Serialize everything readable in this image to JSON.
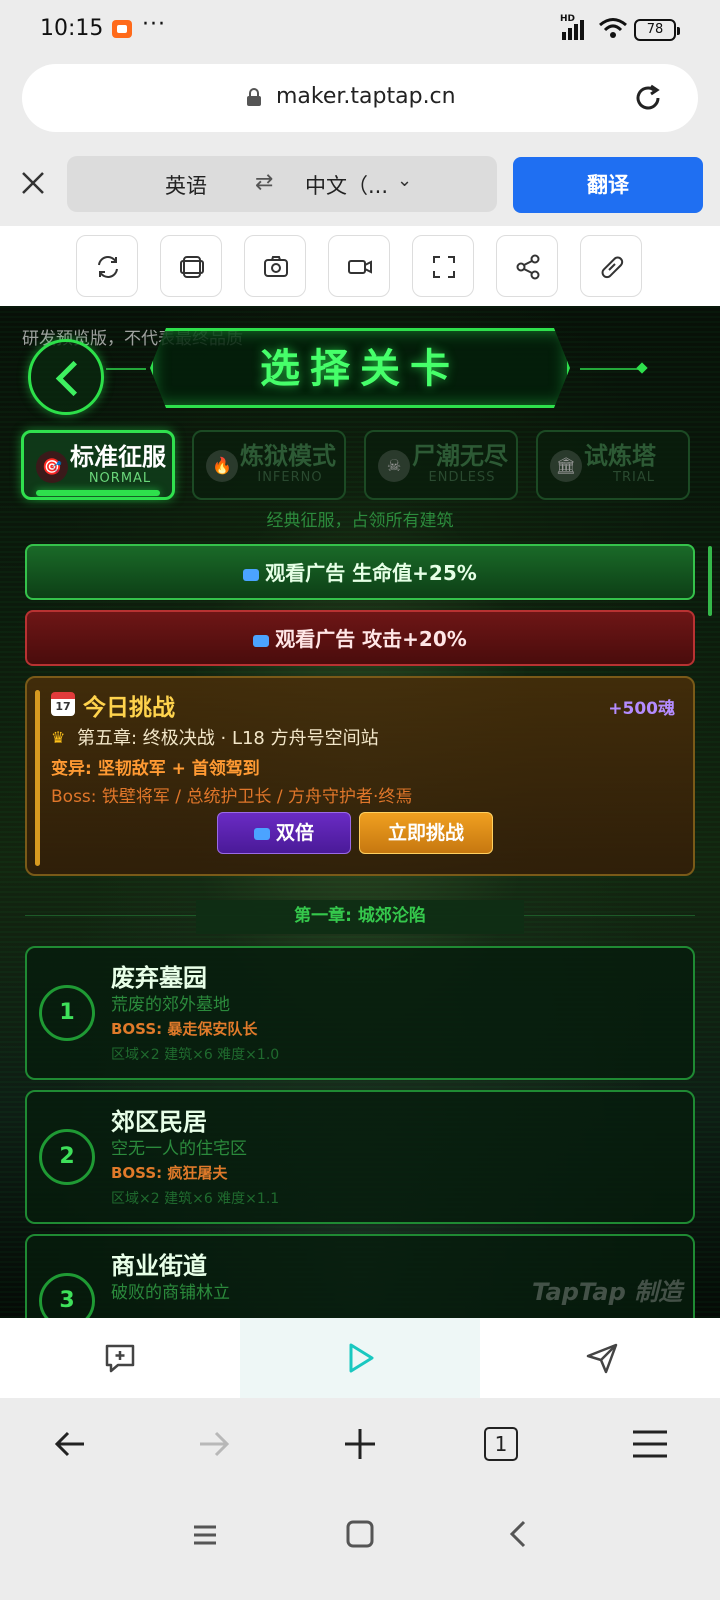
{
  "status_bar": {
    "time": "10:15",
    "dots": "···",
    "hd_label": "HD",
    "battery": "78"
  },
  "browser": {
    "url": "maker.taptap.cn"
  },
  "translate": {
    "source_lang": "英语",
    "swap_symbol": "⇄",
    "target_lang": "中文（...",
    "chevron": "⌄",
    "button": "翻译"
  },
  "tools": [
    "refresh-icon",
    "copy-icon",
    "screenshot-icon",
    "record-icon",
    "fullscreen-icon",
    "share-icon",
    "link-icon"
  ],
  "game": {
    "preview_note": "研发预览版，不代表最终品质",
    "title": "选择关卡",
    "modes": [
      {
        "title": "标准征服",
        "sub": "NORMAL",
        "icon": "🎯"
      },
      {
        "title": "炼狱模式",
        "sub": "INFERNO",
        "icon": "🔥"
      },
      {
        "title": "尸潮无尽",
        "sub": "ENDLESS",
        "icon": "☠"
      },
      {
        "title": "试炼塔",
        "sub": "TRIAL",
        "icon": "🏛"
      }
    ],
    "mode_desc": "经典征服，占领所有建筑",
    "ads": {
      "hp": "观看广告 生命值+25%",
      "atk": "观看广告 攻击+20%"
    },
    "daily": {
      "calendar_day": "17",
      "title": "今日挑战",
      "reward": "+500魂",
      "line1": "第五章: 终极决战 · L18 方舟号空间站",
      "line2": "变异: 坚韧敌军 + 首领驾到",
      "line3": "Boss: 铁壁将军 / 总统护卫长 / 方舟守护者·终焉",
      "double_btn": "双倍",
      "challenge_btn": "立即挑战"
    },
    "chapter": "第一章: 城郊沦陷",
    "levels": [
      {
        "num": "1",
        "name": "废弃墓园",
        "desc": "荒废的郊外墓地",
        "boss": "BOSS: 暴走保安队长",
        "stats": "区域×2  建筑×6  难度×1.0"
      },
      {
        "num": "2",
        "name": "郊区民居",
        "desc": "空无一人的住宅区",
        "boss": "BOSS: 疯狂屠夫",
        "stats": "区域×2  建筑×6  难度×1.1"
      },
      {
        "num": "3",
        "name": "商业街道",
        "desc": "破败的商铺林立",
        "boss": "",
        "stats": ""
      }
    ],
    "watermark": "TapTap 制造"
  },
  "bottom_toolbar": [
    "comment-icon",
    "play-icon",
    "send-icon"
  ],
  "nav": {
    "tab_count": "1"
  },
  "colors": {
    "accent_green": "#2ee04c",
    "translate_blue": "#1f6ff2",
    "gold": "#ffd34d"
  }
}
